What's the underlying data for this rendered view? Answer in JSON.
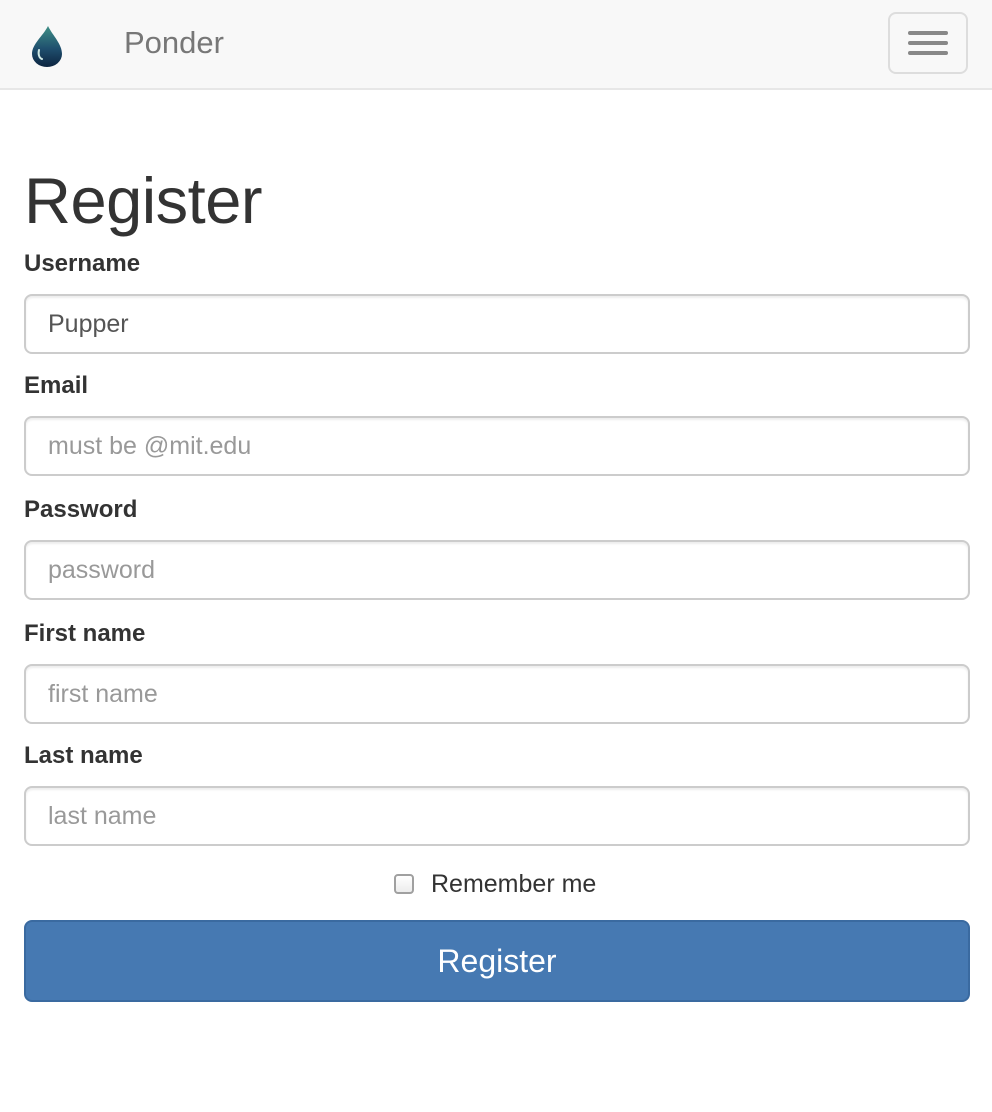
{
  "navbar": {
    "brand_name": "Ponder",
    "logo_icon": "water-drop-icon",
    "toggle_icon": "hamburger-menu-icon"
  },
  "form": {
    "title": "Register",
    "fields": [
      {
        "label": "Username",
        "value": "Pupper",
        "placeholder": ""
      },
      {
        "label": "Email",
        "value": "",
        "placeholder": "must be @mit.edu"
      },
      {
        "label": "Password",
        "value": "",
        "placeholder": "password"
      },
      {
        "label": "First name",
        "value": "",
        "placeholder": "first name"
      },
      {
        "label": "Last name",
        "value": "",
        "placeholder": "last name"
      }
    ],
    "remember_label": "Remember me",
    "remember_checked": false,
    "submit_label": "Register"
  },
  "colors": {
    "primary_button": "#4679b2",
    "navbar_bg": "#f8f8f8",
    "brand_text": "#777777"
  }
}
